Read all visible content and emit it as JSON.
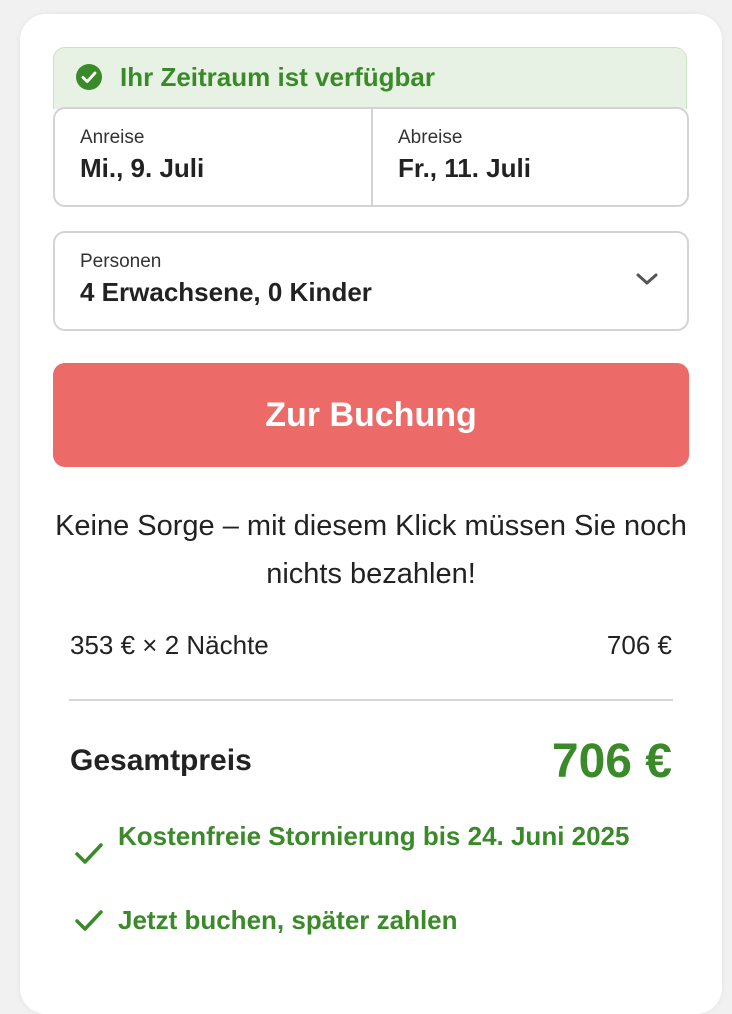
{
  "availability": {
    "text": "Ihr Zeitraum ist verfügbar",
    "icon": "check-circle-icon"
  },
  "dates": {
    "arrival_label": "Anreise",
    "arrival_value": "Mi., 9. Juli",
    "departure_label": "Abreise",
    "departure_value": "Fr., 11. Juli"
  },
  "guests": {
    "label": "Personen",
    "value": "4 Erwachsene, 0 Kinder",
    "icon": "chevron-down-icon"
  },
  "booking_button": {
    "label": "Zur Buchung"
  },
  "note": "Keine Sorge – mit diesem Klick müssen Sie noch nichts bezahlen!",
  "pricing": {
    "line_label": "353 € × 2 Nächte",
    "line_amount": "706 €",
    "total_label": "Gesamtpreis",
    "total_amount": "706 €"
  },
  "perks": [
    {
      "text": "Kostenfreie Stornierung bis 24. Juni 2025",
      "icon": "check-icon"
    },
    {
      "text": "Jetzt buchen, später zahlen",
      "icon": "check-icon"
    }
  ],
  "colors": {
    "accent_green": "#3b8a2a",
    "availability_bg": "#e8f2e4",
    "button_bg": "#ec6b69",
    "border": "#d3d3d3"
  }
}
